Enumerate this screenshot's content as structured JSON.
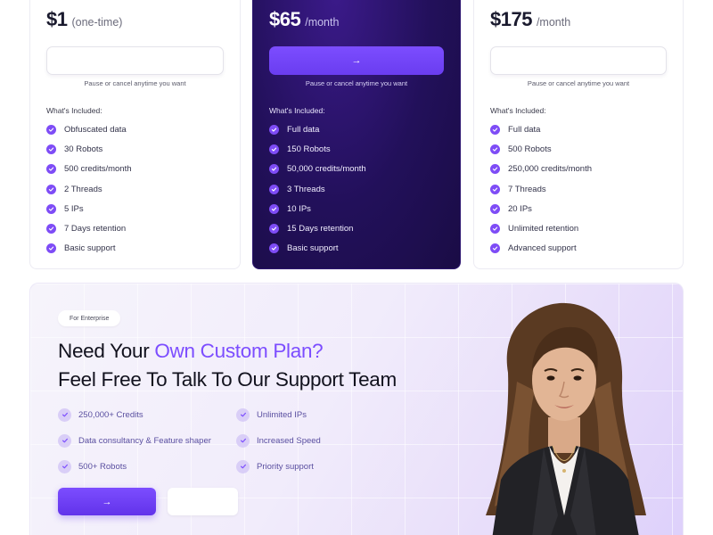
{
  "plans": [
    {
      "price": "$1",
      "period": "(one-time)",
      "cta_label": "",
      "note": "Pause or cancel anytime you want",
      "included_label": "What's Included:",
      "features": [
        "Obfuscated data",
        "30 Robots",
        "500 credits/month",
        "2 Threads",
        "5 IPs",
        "7 Days retention",
        "Basic support"
      ]
    },
    {
      "price": "$65",
      "period": "/month",
      "cta_label": "→",
      "note": "Pause or cancel anytime you want",
      "included_label": "What's Included:",
      "features": [
        "Full data",
        "150 Robots",
        "50,000 credits/month",
        "3 Threads",
        "10 IPs",
        "15 Days retention",
        "Basic support"
      ]
    },
    {
      "price": "$175",
      "period": "/month",
      "cta_label": "",
      "note": "Pause or cancel anytime you want",
      "included_label": "What's Included:",
      "features": [
        "Full data",
        "500 Robots",
        "250,000 credits/month",
        "7 Threads",
        "20 IPs",
        "Unlimited retention",
        "Advanced support"
      ]
    }
  ],
  "enterprise": {
    "pill": "For Enterprise",
    "headline_part1": "Need Your ",
    "headline_accent": "Own Custom Plan?",
    "headline_line2": "Feel Free To Talk To Our Support Team",
    "perks": [
      "250,000+ Credits",
      "Unlimited IPs",
      "Data consultancy & Feature shaper",
      "Increased Speed",
      "500+ Robots",
      "Priority support"
    ],
    "primary_button": "→",
    "secondary_button": ""
  },
  "colors": {
    "accent": "#7c4dff",
    "dark_card": "#22105a",
    "check": "#7e4cf6"
  },
  "icons": {
    "check": "check-icon",
    "arrow": "arrow-right-icon"
  }
}
